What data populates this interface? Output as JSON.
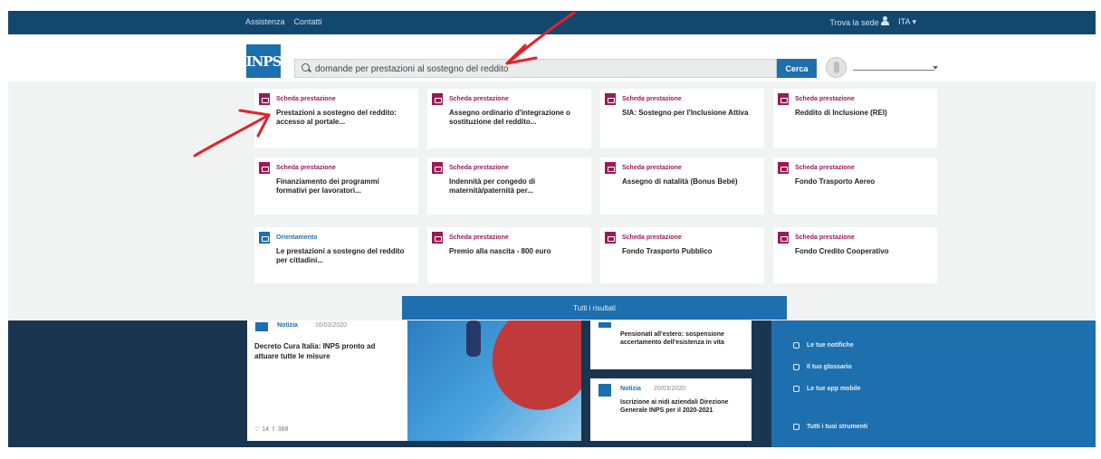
{
  "topbar": {
    "links": [
      "Assistenza",
      "Contatti"
    ],
    "find_office": "Trova la sede",
    "language": "ITA ▾"
  },
  "header": {
    "logo": "INPS",
    "search": {
      "value": "domande per prestazioni al sostegno del reddito",
      "placeholder": "Cerca",
      "button_label": "Cerca"
    }
  },
  "results": [
    {
      "kind": "Scheda prestazione",
      "title": "Prestazioni a sostegno del reddito: accesso al portale..."
    },
    {
      "kind": "Scheda prestazione",
      "title": "Assegno ordinario d'integrazione o sostituzione del reddito..."
    },
    {
      "kind": "Scheda prestazione",
      "title": "SIA: Sostegno per l'Inclusione Attiva"
    },
    {
      "kind": "Scheda prestazione",
      "title": "Reddito di Inclusione (REI)"
    },
    {
      "kind": "Scheda prestazione",
      "title": "Finanziamento dei programmi formativi per lavoratori..."
    },
    {
      "kind": "Scheda prestazione",
      "title": "Indennità per congedo di maternità/paternità per..."
    },
    {
      "kind": "Scheda prestazione",
      "title": "Assegno di natalità (Bonus Bebè)"
    },
    {
      "kind": "Scheda prestazione",
      "title": "Fondo Trasporto Aereo"
    },
    {
      "kind": "Orientamento",
      "title": "Le prestazioni a sostegno del reddito per cittadini..."
    },
    {
      "kind": "Scheda prestazione",
      "title": "Premio alla nascita - 800 euro"
    },
    {
      "kind": "Scheda prestazione",
      "title": "Fondo Trasporto Pubblico"
    },
    {
      "kind": "Scheda prestazione",
      "title": "Fondo Credito Cooperativo"
    }
  ],
  "all_results_label": "Tutti i risultati",
  "news": {
    "first": {
      "tag": "Notizia",
      "date": "16/03/2020",
      "title": "Decreto Cura Italia: INPS pronto ad attuare tutte le misure",
      "meta": "♡ 14  ⇧ 368"
    },
    "second": {
      "title": "Pensionati all'estero: sospensione accertamento dell'esistenza in vita"
    },
    "third": {
      "tag": "Notizia",
      "date": "20/03/2020",
      "title": "Iscrizione ai nidi aziendali Direzione Generale INPS per il 2020-2021"
    }
  },
  "tools_panel": {
    "items": [
      "Le tue notifiche",
      "Il tuo glossario",
      "Le tue app mobile"
    ],
    "all_tools": "Tutti i tuoi strumenti"
  },
  "colors": {
    "brand_blue": "#1d6fae",
    "topbar": "#12476e",
    "accent_magenta": "#9c1957",
    "annotation_red": "#e0242a"
  }
}
